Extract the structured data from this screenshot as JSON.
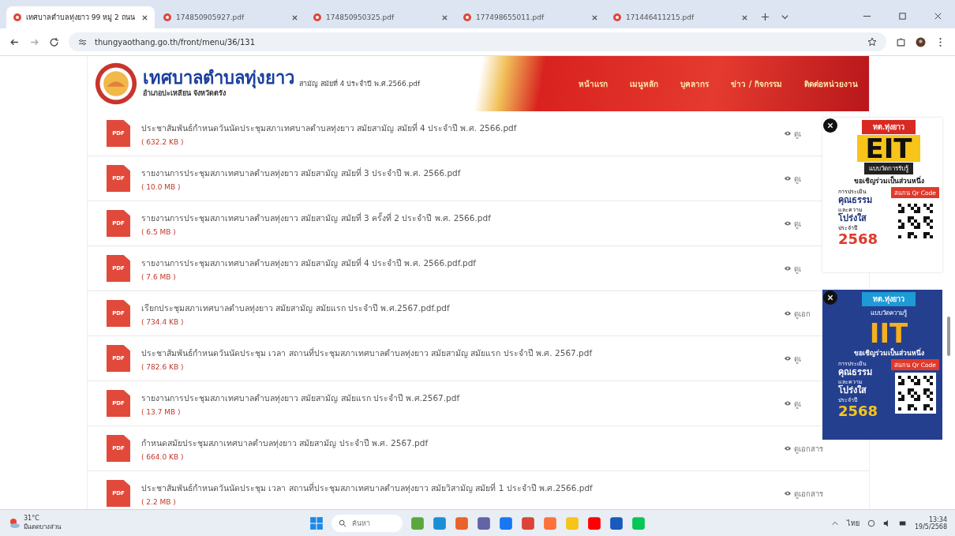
{
  "browser": {
    "tabs": [
      {
        "title": "เทศบาลตำบลทุ่งยาว 99 หมู่ 2 ถนน",
        "selected": true
      },
      {
        "title": "174850905927.pdf",
        "selected": false
      },
      {
        "title": "174850950325.pdf",
        "selected": false
      },
      {
        "title": "177498655011.pdf",
        "selected": false
      },
      {
        "title": "171446411215.pdf",
        "selected": false
      }
    ],
    "url": "thungyaothang.go.th/front/menu/36/131"
  },
  "header": {
    "logo_title": "เทศบาลตำบลทุ่งยาว",
    "logo_subtitle": "อำเภอปะเหลียน จังหวัดตรัง",
    "behind_text": "สามัญ สมัยที่ 4 ประจำปี พ.ศ.2566.pdf",
    "nav": [
      "หน้าแรก",
      "เมนูหลัก",
      "บุคลากร",
      "ข่าว / กิจกรรม",
      "ติดต่อหน่วยงาน"
    ]
  },
  "documents": [
    {
      "icon": "PDF",
      "title": "ประชาสัมพันธ์กำหนดวันนัดประชุมสภาเทศบาลตำบลทุ่งยาว สมัยสามัญ สมัยที่ 4 ประจำปี พ.ศ. 2566.pdf",
      "size": "( 632.2 KB )",
      "view": "ดูเ"
    },
    {
      "icon": "PDF",
      "title": "รายงานการประชุมสภาเทศบาลตำบลทุ่งยาว สมัยสามัญ สมัยที่ 3 ประจำปี พ.ศ. 2566.pdf",
      "size": "( 10.0 MB )",
      "view": "ดูเ"
    },
    {
      "icon": "PDF",
      "title": "รายงานการประชุมสภาเทศบาลตำบลทุ่งยาว สมัยสามัญ สมัยที่ 3 ครั้งที่ 2 ประจำปี พ.ศ. 2566.pdf",
      "size": "( 6.5 MB )",
      "view": "ดูเ"
    },
    {
      "icon": "PDF",
      "title": "รายงานการประชุมสภาเทศบาลตำบลทุ่งยาว สมัยสามัญ สมัยที่ 4 ประจำปี พ.ศ. 2566.pdf.pdf",
      "size": "( 7.6 MB )",
      "view": "ดูเ"
    },
    {
      "icon": "PDF",
      "title": "เรียกประชุมสภาเทศบาลตำบลทุ่งยาว สมัยสามัญ สมัยแรก ประจำปี พ.ศ.2567.pdf.pdf",
      "size": "( 734.4 KB )",
      "view": "ดูเอก"
    },
    {
      "icon": "PDF",
      "title": "ประชาสัมพันธ์กำหนดวันนัดประชุม เวลา สถานที่ประชุมสภาเทศบาลตำบลทุ่งยาว สมัยสามัญ สมัยแรก ประจำปี พ.ศ. 2567.pdf",
      "size": "( 782.6 KB )",
      "view": "ดูเ"
    },
    {
      "icon": "PDF",
      "title": "รายงานการประชุมสภาเทศบาลตำบลทุ่งยาว สมัยสามัญ สมัยแรก ประจำปี พ.ศ.2567.pdf",
      "size": "( 13.7 MB )",
      "view": "ดูเ"
    },
    {
      "icon": "PDF",
      "title": "กำหนดสมัยประชุมสภาเทศบาลตำบลทุ่งยาว สมัยสามัญ ประจำปี พ.ศ. 2567.pdf",
      "size": "( 664.0 KB )",
      "view": "ดูเอกสาร"
    },
    {
      "icon": "PDF",
      "title": "ประชาสัมพันธ์กำหนดวันนัดประชุม เวลา สถานที่ประชุมสภาเทศบาลตำบลทุ่งยาว สมัยวิสามัญ สมัยที่ 1 ประจำปี พ.ศ.2566.pdf",
      "size": "( 2.2 MB )",
      "view": "ดูเอกสาร"
    }
  ],
  "banners": [
    {
      "kind": "eit",
      "badge": "ทต.ทุ่งยาว",
      "title": "EIT",
      "subtitle": "แบบวัดการรับรู้",
      "invite": "ขอเชิญร่วมเป็นส่วนหนึ่ง",
      "small1": "การประเมิน",
      "big1": "คุณธรรม",
      "small2": "และความ",
      "big2": "โปร่งใส",
      "small3": "ประจำปี",
      "year": "2568",
      "scan": "สแกน Qr Code"
    },
    {
      "kind": "iit",
      "badge": "ทต.ทุ่งยาว",
      "title": "IIT",
      "subtitle": "แบบวัดความรู้",
      "invite": "ขอเชิญร่วมเป็นส่วนหนึ่ง",
      "small1": "การประเมิน",
      "big1": "คุณธรรม",
      "small2": "และความ",
      "big2": "โปร่งใส",
      "small3": "ประจำปี",
      "year": "2568",
      "scan": "สแกน Qr Code"
    }
  ],
  "taskbar": {
    "weather_temp": "31°C",
    "weather_text": "มีแดดบางส่วน",
    "search_placeholder": "ค้นหา",
    "apps": [
      {
        "color": "#5aa83c"
      },
      {
        "color": "#1b8fd6"
      },
      {
        "color": "#e9622a"
      },
      {
        "color": "#6264a7"
      },
      {
        "color": "#1877f2"
      },
      {
        "color": "#db4437"
      },
      {
        "color": "#ff7139"
      },
      {
        "color": "#f5c518"
      },
      {
        "color": "#ff0000"
      },
      {
        "color": "#185abd"
      },
      {
        "color": "#06c755"
      }
    ],
    "language": "ไทย",
    "time": "13:34",
    "date": "19/5/2568"
  }
}
